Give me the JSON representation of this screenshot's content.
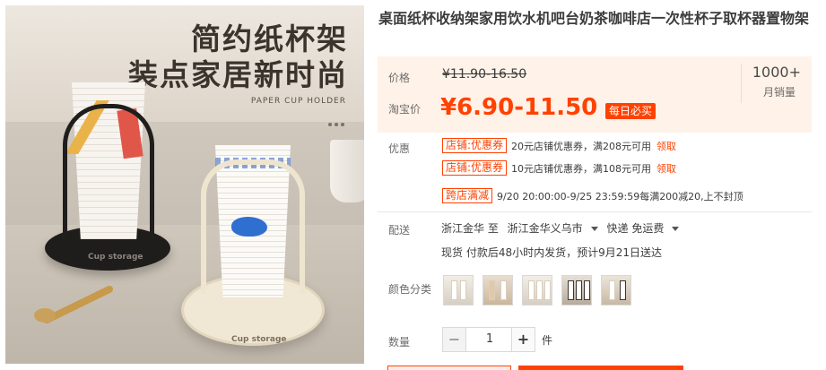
{
  "product_image": {
    "headline_1": "简约纸杯架",
    "headline_2": "装点家居新时尚",
    "caption": "PAPER CUP HOLDER",
    "holder_label_black": "Cup storage",
    "holder_label_cream": "Cup storage"
  },
  "product": {
    "title": "桌面纸杯收纳架家用饮水机吧台奶茶咖啡店一次性杯子取杯器置物架"
  },
  "price": {
    "label": "价格",
    "original": "¥11.90-16.50",
    "promo_label": "淘宝价",
    "promo": "¥6.90-11.50",
    "badge": "每日必买",
    "sales_count": "1000+",
    "sales_label": "月销量"
  },
  "promotions": {
    "label": "优惠",
    "items": [
      {
        "tag": "店铺:优惠券",
        "text": "20元店铺优惠券，满208元可用",
        "link": "领取"
      },
      {
        "tag": "店铺:优惠券",
        "text": "10元店铺优惠券，满108元可用",
        "link": "领取"
      },
      {
        "tag": "跨店满减",
        "text": "9/20 20:00:00-9/25 23:59:59每满200减20,上不封顶",
        "link": ""
      }
    ]
  },
  "delivery": {
    "label": "配送",
    "from": "浙江金华 至",
    "to": "浙江金华义乌市",
    "method": "快递 免运费",
    "note": "现货 付款后48小时内发货，预计9月21日送达"
  },
  "variants": {
    "label": "颜色分类",
    "count": 5
  },
  "quantity": {
    "label": "数量",
    "minus": "−",
    "value": "1",
    "plus": "+",
    "unit": "件"
  },
  "colors": {
    "accent": "#ff4200",
    "price_bg": "#fff2e8"
  }
}
